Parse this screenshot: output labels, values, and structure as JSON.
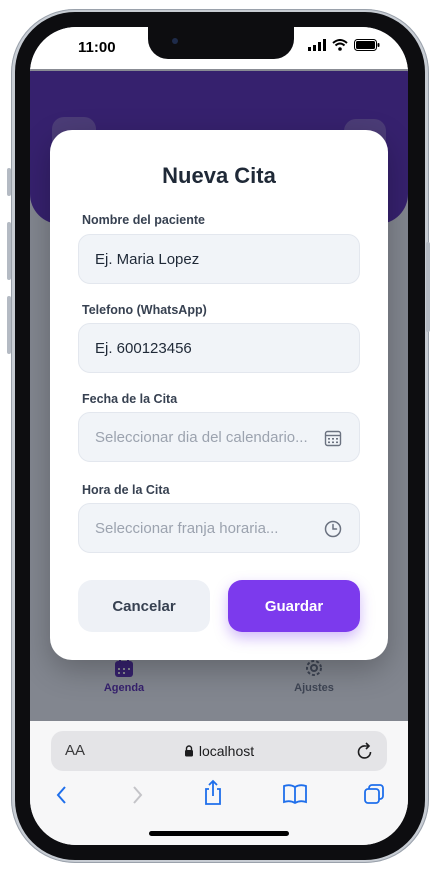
{
  "status_bar": {
    "time": "11:00"
  },
  "modal": {
    "title": "Nueva Cita",
    "fields": [
      {
        "label": "Nombre del paciente",
        "value": "Ej. Maria Lopez",
        "placeholder": ""
      },
      {
        "label": "Telefono (WhatsApp)",
        "value": "Ej. 600123456",
        "placeholder": ""
      },
      {
        "label": "Fecha de la Cita",
        "value": "",
        "placeholder": "Seleccionar dia del calendario...",
        "icon": "calendar-icon"
      },
      {
        "label": "Hora de la Cita",
        "value": "",
        "placeholder": "Seleccionar franja horaria...",
        "icon": "clock-icon"
      }
    ],
    "cancel_label": "Cancelar",
    "save_label": "Guardar"
  },
  "bottom_nav": {
    "items": [
      {
        "label": "Agenda",
        "icon": "calendar-icon"
      },
      {
        "label": "Ajustes",
        "icon": "gear-icon"
      }
    ]
  },
  "browser": {
    "text_size_label": "AA",
    "url": "localhost",
    "toolbar_icons": [
      "back-icon",
      "forward-icon",
      "share-icon",
      "bookmarks-icon",
      "tabs-icon"
    ]
  },
  "colors": {
    "accent": "#7c3aed",
    "header": "#5b2bb4"
  }
}
